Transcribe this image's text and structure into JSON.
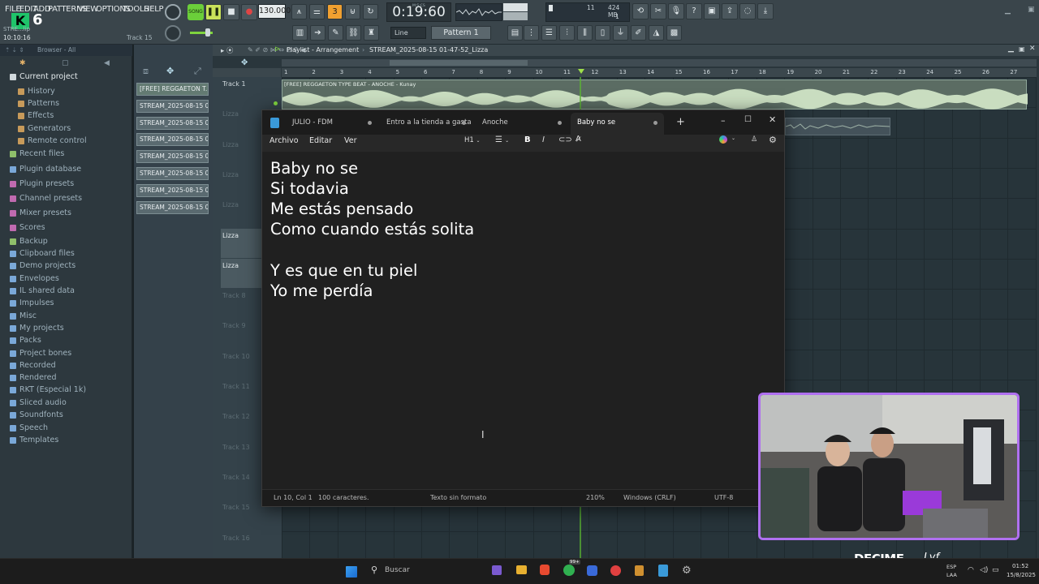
{
  "fl": {
    "menu": [
      "FILE",
      "EDIT",
      "ADD",
      "PATTERNS",
      "VIEW",
      "OPTIONS",
      "TOOLS",
      "HELP"
    ],
    "overlay_digit": "6",
    "song_label": "SONG",
    "tempo": "130.000",
    "time": "0:19:60",
    "time_unit": "M:S:CS",
    "cpu": "11",
    "memory": "424 MB",
    "poly": "1",
    "hint_left": "STRE...lip",
    "hint_time": "10:10:16",
    "hint_track": "Track 15",
    "snap": "Line",
    "pattern": "Pattern 1"
  },
  "browser": {
    "title": "Browser - All",
    "items": [
      {
        "label": "Current project",
        "color": "#d0d8dc"
      },
      {
        "label": "History",
        "color": "#c79a5a"
      },
      {
        "label": "Patterns",
        "color": "#c79a5a"
      },
      {
        "label": "Effects",
        "color": "#c79a5a"
      },
      {
        "label": "Generators",
        "color": "#c79a5a"
      },
      {
        "label": "Remote control",
        "color": "#c79a5a"
      },
      {
        "label": "Recent files",
        "color": "#8fbf6a"
      },
      {
        "label": "Plugin database",
        "color": "#7aa8d8"
      },
      {
        "label": "Plugin presets",
        "color": "#c06ab0"
      },
      {
        "label": "Channel presets",
        "color": "#c06ab0"
      },
      {
        "label": "Mixer presets",
        "color": "#c06ab0"
      },
      {
        "label": "Scores",
        "color": "#c06ab0"
      },
      {
        "label": "Backup",
        "color": "#8fbf6a"
      },
      {
        "label": "Clipboard files",
        "color": "#7aa8d8"
      },
      {
        "label": "Demo projects",
        "color": "#7aa8d8"
      },
      {
        "label": "Envelopes",
        "color": "#7aa8d8"
      },
      {
        "label": "IL shared data",
        "color": "#7aa8d8"
      },
      {
        "label": "Impulses",
        "color": "#7aa8d8"
      },
      {
        "label": "Misc",
        "color": "#7aa8d8"
      },
      {
        "label": "My projects",
        "color": "#7aa8d8"
      },
      {
        "label": "Packs",
        "color": "#7aa8d8"
      },
      {
        "label": "Project bones",
        "color": "#7aa8d8"
      },
      {
        "label": "Recorded",
        "color": "#7aa8d8"
      },
      {
        "label": "Rendered",
        "color": "#7aa8d8"
      },
      {
        "label": "RKT (Especial 1k)",
        "color": "#7aa8d8"
      },
      {
        "label": "Sliced audio",
        "color": "#7aa8d8"
      },
      {
        "label": "Soundfonts",
        "color": "#7aa8d8"
      },
      {
        "label": "Speech",
        "color": "#7aa8d8"
      },
      {
        "label": "Templates",
        "color": "#7aa8d8"
      }
    ]
  },
  "patterns": [
    "[FREE] REGGAETON T...",
    "STREAM_2025-08-15 01-...",
    "STREAM_2025-08-15 01-...",
    "STREAM_2025-08-15 01-...",
    "STREAM_2025-08-15 01-...",
    "STREAM_2025-08-15 01-...",
    "STREAM_2025-08-15 01-...",
    "STREAM_2025-08-15 01-..."
  ],
  "playlist": {
    "title": "Playlist - Arrangement",
    "project": "STREAM_2025-08-15 01-47-52_Lizza",
    "bars": [
      "1",
      "2",
      "3",
      "4",
      "5",
      "6",
      "7",
      "8",
      "9",
      "10",
      "11",
      "12",
      "13",
      "14",
      "15",
      "16",
      "17",
      "18",
      "19",
      "20",
      "21",
      "22",
      "23",
      "24",
      "25",
      "26",
      "27"
    ],
    "clip_label": "[FREE] REGGAETON TYPE BEAT - ANOCHE - Kunay",
    "tracks": [
      "Track 1",
      "Lizza",
      "Lizza",
      "Lizza",
      "Lizza",
      "Lizza",
      "Lizza",
      "Track 8",
      "Track 9",
      "Track 10",
      "Track 11",
      "Track 12",
      "Track 13",
      "Track 14",
      "Track 15",
      "Track 16"
    ]
  },
  "notepad": {
    "tabs": [
      "JULIO - FDM",
      "Entro a la tienda a gasta",
      "Anoche",
      "Baby no se"
    ],
    "menu": [
      "Archivo",
      "Editar",
      "Ver"
    ],
    "heading": "H1",
    "lines": [
      "Baby no se",
      "Si todavia",
      "Me estás pensado",
      "Como cuando estás solita",
      "",
      "Y es que en tu piel",
      "Yo me perdía"
    ],
    "status": {
      "pos": "Ln 10, Col 1",
      "chars": "100 caracteres.",
      "format": "Texto sin formato",
      "zoom": "210%",
      "eol": "Windows (CRLF)",
      "enc": "UTF-8"
    }
  },
  "overlay": {
    "brand": "DECIME",
    "script": "Lyf"
  },
  "taskbar": {
    "search": "Buscar",
    "lang": "ESP",
    "lang2": "LAA",
    "time": "01:52",
    "date": "15/8/2025",
    "badge": "99+"
  }
}
